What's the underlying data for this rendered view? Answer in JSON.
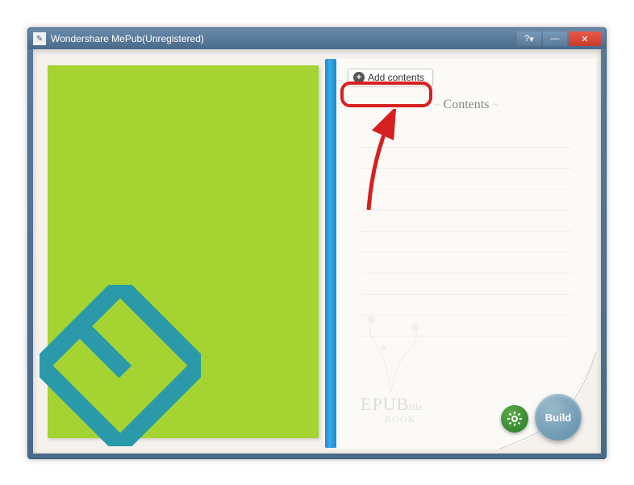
{
  "window": {
    "title": "Wondershare MePub(Unregistered)"
  },
  "titlebar": {
    "help_label": "?",
    "min_label": "—",
    "close_label": "✕"
  },
  "right_page": {
    "add_contents_label": "Add contents",
    "contents_heading": "Contents"
  },
  "watermark": {
    "line1_big": "EPUB",
    "line1_small": "file",
    "line2": "BOOK"
  },
  "buttons": {
    "build_label": "Build"
  }
}
